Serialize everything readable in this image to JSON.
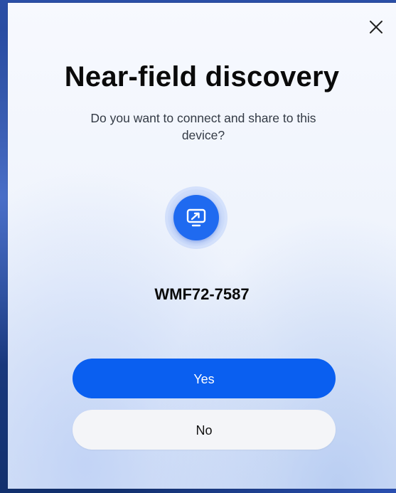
{
  "dialog": {
    "title": "Near-field discovery",
    "subtitle": "Do you want to connect and share to this device?",
    "close_icon": "close-icon",
    "device": {
      "icon": "screen-share-icon",
      "name": "WMF72-7587"
    },
    "buttons": {
      "yes_label": "Yes",
      "no_label": "No"
    }
  },
  "colors": {
    "accent": "#0a5ff0",
    "device_icon_bg": "#1f6af0",
    "secondary_button_bg": "#f4f5f8",
    "title_text": "#0a0a0a"
  }
}
